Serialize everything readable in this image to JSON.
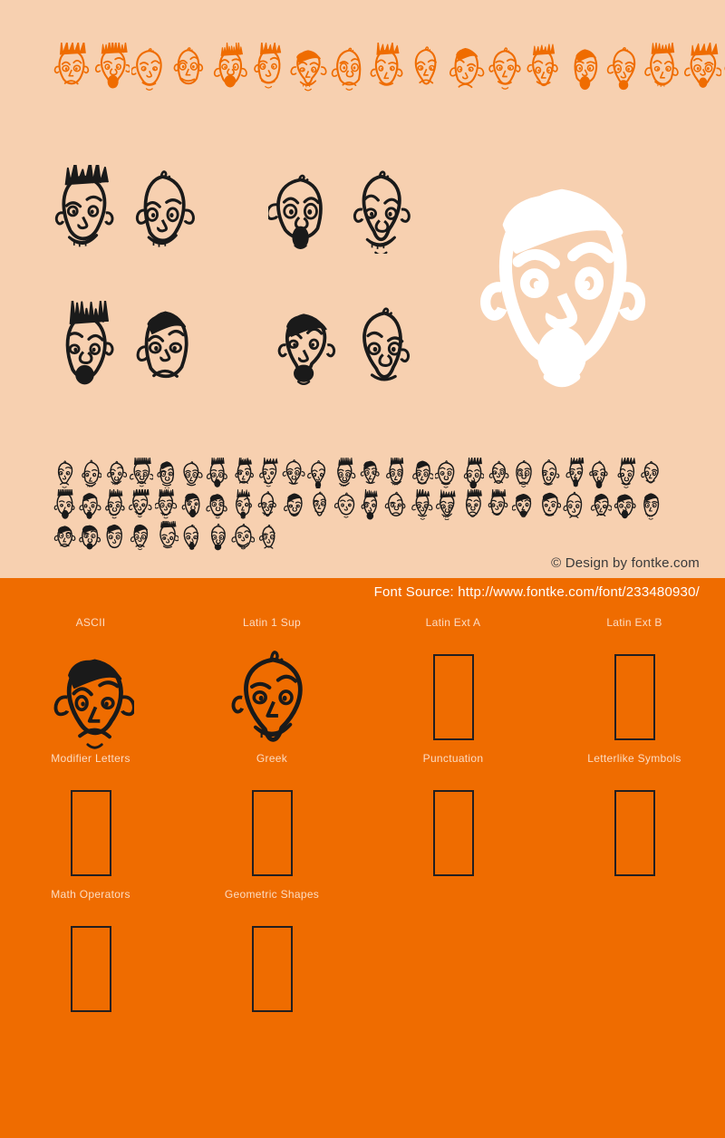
{
  "preview": {
    "background_color": "#f7d0b0",
    "top_strip": {
      "glyph_color": "#ef6c00",
      "glyph_count": 20,
      "description": "cartoon-face-glyph-row"
    },
    "showcase": {
      "glyph_color": "#1a1a1a",
      "rows": [
        {
          "cells": [
            {
              "faces": [
                "sad-droopy-face",
                "bald-worried-face"
              ]
            },
            {
              "faces": [
                "wide-eyed-face",
                "smug-grin-face"
              ]
            }
          ]
        },
        {
          "cells": [
            {
              "faces": [
                "frowning-man-face",
                "shocked-open-mouth-face"
              ]
            },
            {
              "faces": [
                "grimacing-teeth-face",
                "long-narrow-face"
              ]
            }
          ]
        }
      ]
    },
    "hero": {
      "glyph_color": "#ffffff",
      "name": "big-nosed-bald-face"
    },
    "waterfall": {
      "glyph_color": "#1a1a1a",
      "glyph_count": 57,
      "description": "full-character-set-waterfall"
    },
    "copyright": "© Design by fontke.com"
  },
  "coverage": {
    "background_color": "#ef6c00",
    "label_color": "#fcdcc2",
    "font_source": "Font Source: http://www.fontke.com/font/233480930/",
    "blocks": [
      {
        "label": "ASCII",
        "sample": "glyph",
        "glyph": "grinning-toothy-face"
      },
      {
        "label": "Latin 1 Sup",
        "sample": "glyph",
        "glyph": "smiling-bald-clown-face"
      },
      {
        "label": "Latin Ext A",
        "sample": "tofu"
      },
      {
        "label": "Latin Ext B",
        "sample": "tofu"
      },
      {
        "label": "Modifier Letters",
        "sample": "tofu"
      },
      {
        "label": "Greek",
        "sample": "tofu"
      },
      {
        "label": "Punctuation",
        "sample": "tofu"
      },
      {
        "label": "Letterlike Symbols",
        "sample": "tofu"
      },
      {
        "label": "Math Operators",
        "sample": "tofu"
      },
      {
        "label": "Geometric Shapes",
        "sample": "tofu"
      }
    ]
  }
}
